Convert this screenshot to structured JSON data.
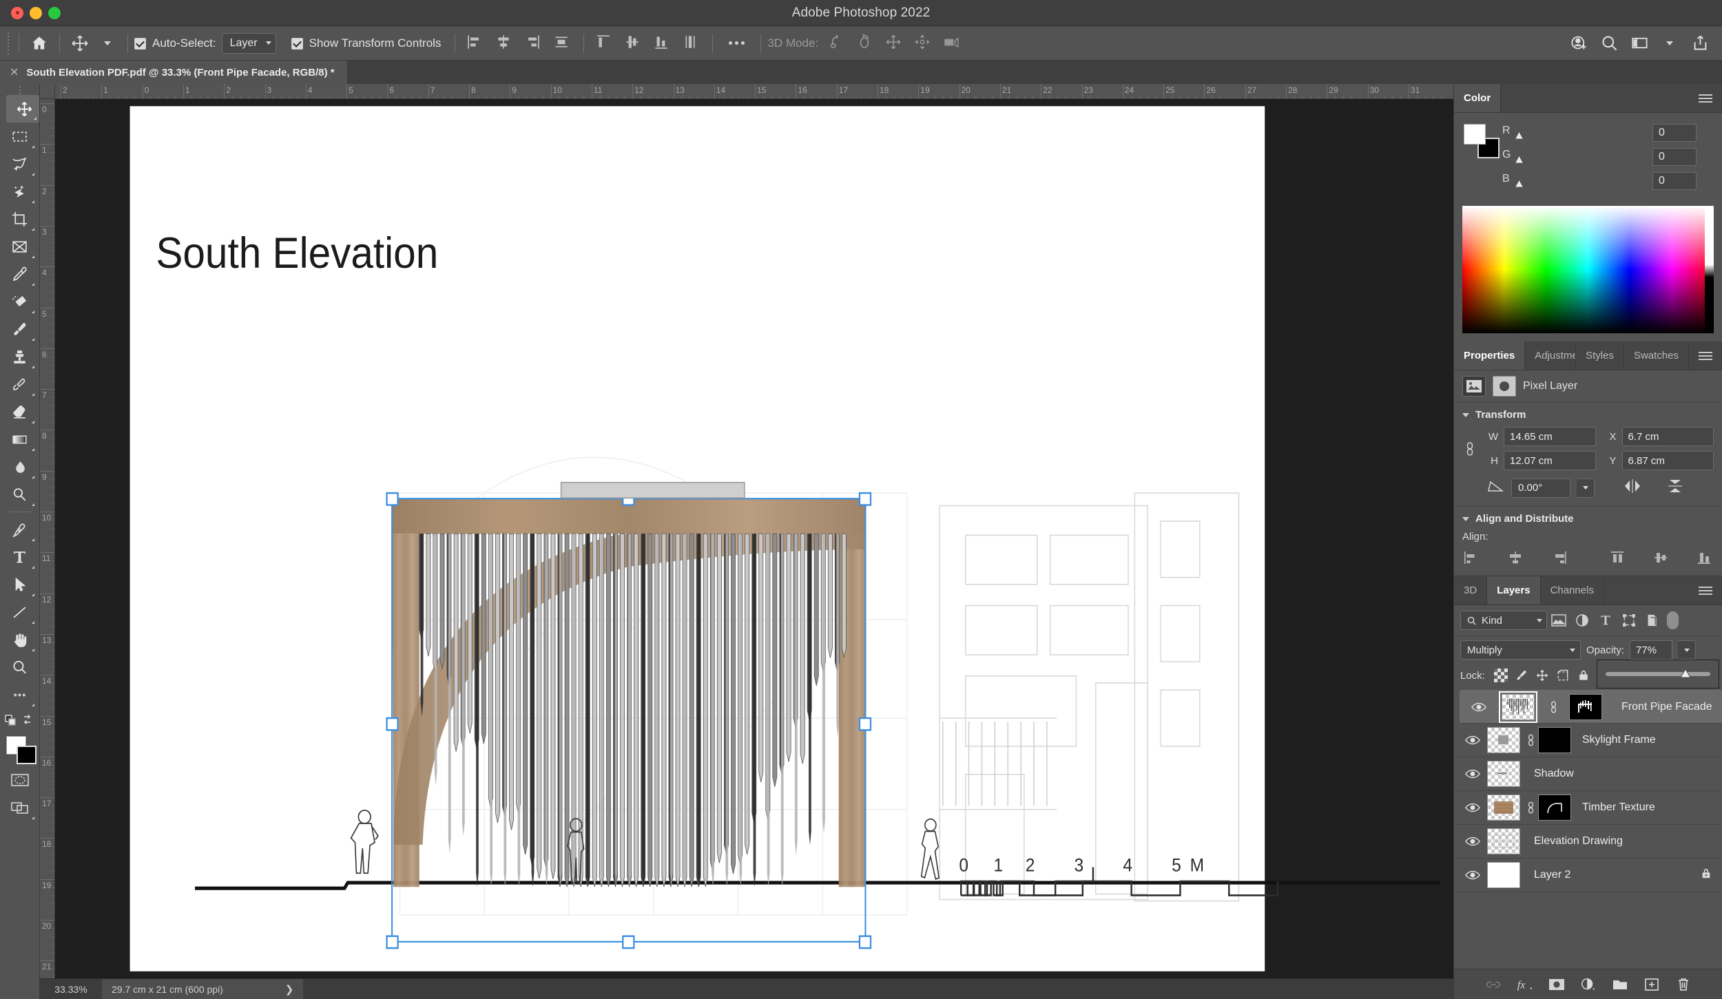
{
  "window": {
    "title": "Adobe Photoshop 2022"
  },
  "options_bar": {
    "home_icon": "home-icon",
    "tool_icon": "move-tool-icon",
    "auto_select_label": "Auto-Select:",
    "auto_select_value": "Layer",
    "auto_select_checked": true,
    "show_transform_label": "Show Transform Controls",
    "show_transform_checked": true,
    "align_icons": [
      "align-left-edges",
      "align-horizontal-centers",
      "align-right-edges",
      "distribute-horizontally"
    ],
    "distribute_icons": [
      "align-top-edges",
      "align-vertical-centers",
      "align-bottom-edges",
      "distribute-vertically"
    ],
    "more_label": "•••",
    "mode_3d_label": "3D Mode:",
    "mode_3d_icons": [
      "rotate-3d-icon",
      "roll-3d-icon",
      "pan-3d-icon",
      "slide-3d-icon",
      "scale-3d-camera-icon"
    ],
    "right_icons": [
      "add-user-icon",
      "search-icon",
      "workspace-icon",
      "chevron-down-icon",
      "share-icon"
    ]
  },
  "document": {
    "tab_label": "South Elevation PDF.pdf @ 33.3% (Front Pipe Facade, RGB/8) *",
    "close_icon": "close-icon"
  },
  "tools": [
    {
      "name": "move-tool",
      "selected": true
    },
    {
      "name": "rectangular-marquee-tool",
      "selected": false
    },
    {
      "name": "lasso-tool",
      "selected": false
    },
    {
      "name": "object-selection-tool",
      "selected": false
    },
    {
      "name": "crop-tool",
      "selected": false
    },
    {
      "name": "frame-tool",
      "selected": false
    },
    {
      "name": "eyedropper-tool",
      "selected": false
    },
    {
      "name": "spot-healing-brush-tool",
      "selected": false
    },
    {
      "name": "brush-tool",
      "selected": false
    },
    {
      "name": "clone-stamp-tool",
      "selected": false
    },
    {
      "name": "history-brush-tool",
      "selected": false
    },
    {
      "name": "eraser-tool",
      "selected": false
    },
    {
      "name": "gradient-tool",
      "selected": false
    },
    {
      "name": "blur-tool",
      "selected": false
    },
    {
      "name": "dodge-tool",
      "selected": false
    },
    {
      "name": "pen-tool",
      "selected": false
    },
    {
      "name": "type-tool",
      "selected": false
    },
    {
      "name": "path-selection-tool",
      "selected": false
    },
    {
      "name": "line-shape-tool",
      "selected": false
    },
    {
      "name": "hand-tool",
      "selected": false
    },
    {
      "name": "zoom-tool",
      "selected": false
    },
    {
      "name": "edit-toolbar-tool",
      "selected": false
    }
  ],
  "rulers": {
    "horizontal_labels": [
      "2",
      "1",
      "0",
      "1",
      "2",
      "3",
      "4",
      "5",
      "6",
      "7",
      "8",
      "9",
      "10",
      "11",
      "12",
      "13",
      "14",
      "15",
      "16",
      "17",
      "18",
      "19",
      "20",
      "21",
      "22",
      "23",
      "24",
      "25",
      "26",
      "27",
      "28",
      "29",
      "30",
      "31"
    ],
    "vertical_labels": [
      "0",
      "1",
      "2",
      "3",
      "4",
      "5",
      "6",
      "7",
      "8",
      "9",
      "10",
      "11",
      "12",
      "13",
      "14",
      "15",
      "16",
      "17",
      "18",
      "19",
      "20",
      "21"
    ],
    "unit": "cm"
  },
  "canvas": {
    "artwork_title": "South Elevation",
    "scale_bar": {
      "labels": [
        "0",
        "1",
        "2",
        "3",
        "4",
        "5"
      ],
      "unit": "M"
    },
    "selection": {
      "handles": 8,
      "color": "#3d8fe0"
    }
  },
  "status_bar": {
    "zoom": "33.33%",
    "doc_info": "29.7 cm x 21 cm (600 ppi)",
    "arrow_icon": "chevron-right-icon"
  },
  "color_panel": {
    "tab_label": "Color",
    "menu_icon": "panel-menu-icon",
    "foreground": "#ffffff",
    "background": "#000000",
    "channels": [
      {
        "name": "R",
        "value": "0"
      },
      {
        "name": "G",
        "value": "0"
      },
      {
        "name": "B",
        "value": "0"
      }
    ]
  },
  "properties_panel": {
    "tabs": [
      {
        "label": "Properties",
        "active": true
      },
      {
        "label": "Adjustme",
        "active": false
      },
      {
        "label": "Styles",
        "active": false
      },
      {
        "label": "Swatches",
        "active": false
      }
    ],
    "menu_icon": "panel-menu-icon",
    "layer_kind": "Pixel Layer",
    "layer_kind_icon": "pixel-layer-icon",
    "mask_icon": "layer-mask-icon",
    "transform": {
      "section_label": "Transform",
      "link_icon": "link-aspect-ratio-icon",
      "w_label": "W",
      "w_value": "14.65 cm",
      "h_label": "H",
      "h_value": "12.07 cm",
      "x_label": "X",
      "x_value": "6.7 cm",
      "y_label": "Y",
      "y_value": "6.87 cm",
      "angle_icon": "angle-icon",
      "angle_value": "0.00°",
      "flip_horizontal_icon": "flip-horizontal-icon",
      "flip_vertical_icon": "flip-vertical-icon"
    },
    "align": {
      "section_label": "Align and Distribute",
      "align_label": "Align:",
      "icons": [
        "align-left-edges",
        "align-horizontal-centers",
        "align-right-edges",
        "align-top-edges",
        "align-vertical-centers",
        "align-bottom-edges"
      ]
    }
  },
  "layers_panel": {
    "tabs": [
      {
        "label": "3D",
        "active": false
      },
      {
        "label": "Layers",
        "active": true
      },
      {
        "label": "Channels",
        "active": false
      }
    ],
    "menu_icon": "panel-menu-icon",
    "filter": {
      "kind_label": "Kind",
      "search_icon": "search-icon",
      "filter_icons": [
        "filter-pixel-icon",
        "filter-adjustment-icon",
        "filter-type-icon",
        "filter-shape-icon",
        "filter-smart-object-icon"
      ],
      "toggle_icon": "filter-toggle-switch"
    },
    "blend_mode": "Multiply",
    "opacity_label": "Opacity:",
    "opacity_value": "77%",
    "opacity_slider_percent": 77,
    "lock_label": "Lock:",
    "lock_icons": [
      "lock-transparent-pixels-icon",
      "lock-image-pixels-icon",
      "lock-position-icon",
      "lock-artboard-nesting-icon",
      "lock-all-icon"
    ],
    "layers": [
      {
        "name": "Front Pipe Facade",
        "visible": true,
        "selected": true,
        "has_mask": true,
        "linked": true,
        "thumb": "pipes",
        "locked": false
      },
      {
        "name": "Skylight Frame",
        "visible": true,
        "selected": false,
        "has_mask": true,
        "linked": true,
        "thumb": "square",
        "locked": false
      },
      {
        "name": "Shadow",
        "visible": true,
        "selected": false,
        "has_mask": false,
        "linked": false,
        "thumb": "shadow",
        "locked": false
      },
      {
        "name": "Timber Texture",
        "visible": true,
        "selected": false,
        "has_mask": true,
        "linked": true,
        "thumb": "timber",
        "locked": false
      },
      {
        "name": "Elevation Drawing",
        "visible": true,
        "selected": false,
        "has_mask": false,
        "linked": false,
        "thumb": "drawing",
        "locked": false
      },
      {
        "name": "Layer 2",
        "visible": true,
        "selected": false,
        "has_mask": false,
        "linked": false,
        "thumb": "white",
        "locked": true
      }
    ],
    "footer_icons": [
      "link-layers-icon",
      "add-layer-style-icon",
      "add-layer-mask-icon",
      "new-adjustment-layer-icon",
      "new-group-icon",
      "new-layer-icon",
      "delete-layer-icon"
    ]
  }
}
